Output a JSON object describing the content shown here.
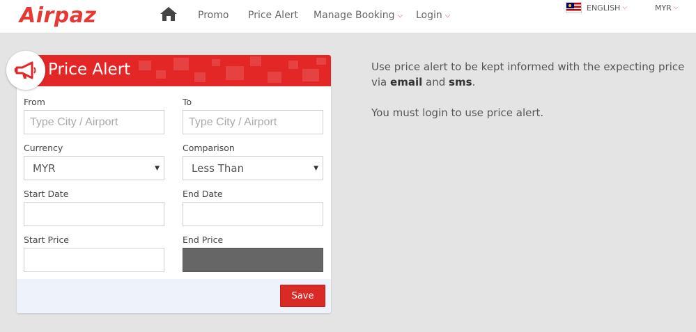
{
  "brand": {
    "name": "Airpaz",
    "accent": "#e53935"
  },
  "nav": {
    "home_icon": "home-icon",
    "items": [
      {
        "label": "Promo"
      },
      {
        "label": "Price Alert"
      },
      {
        "label": "Manage Booking"
      },
      {
        "label": "Login"
      }
    ]
  },
  "locale": {
    "language": "ENGLISH",
    "currency": "MYR",
    "flag_icon": "malaysia-flag-icon"
  },
  "price_alert": {
    "title": "Price Alert",
    "icon": "megaphone-icon",
    "from": {
      "label": "From",
      "placeholder": "Type City / Airport"
    },
    "to": {
      "label": "To",
      "placeholder": "Type City / Airport"
    },
    "currency": {
      "label": "Currency",
      "value": "MYR"
    },
    "comparison": {
      "label": "Comparison",
      "value": "Less Than"
    },
    "start_date": {
      "label": "Start Date",
      "value": ""
    },
    "end_date": {
      "label": "End Date",
      "value": ""
    },
    "start_price": {
      "label": "Start Price",
      "value": ""
    },
    "end_price": {
      "label": "End Price",
      "value": ""
    },
    "save_label": "Save"
  },
  "info": {
    "line1_pre": "Use price alert to be kept informed with the expecting price via",
    "email": "email",
    "and": "and",
    "sms": "sms",
    "period": ".",
    "line2": "You must login to use price alert."
  }
}
